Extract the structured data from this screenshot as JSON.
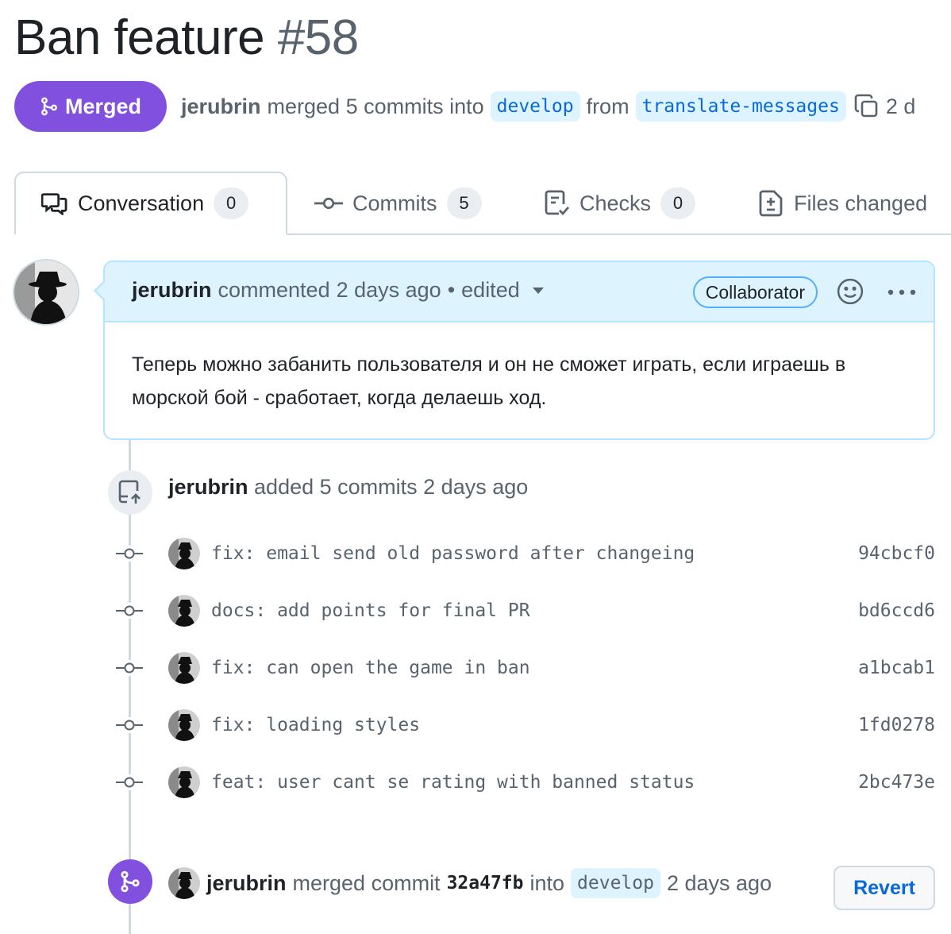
{
  "pr": {
    "title": "Ban feature",
    "number": "#58",
    "state": "Merged",
    "author": "jerubrin",
    "merged_text": "merged 5 commits into",
    "base_branch": "develop",
    "from_text": "from",
    "head_branch": "translate-messages",
    "time_truncated": "2 d"
  },
  "tabs": [
    {
      "label": "Conversation",
      "count": "0",
      "icon": "comment-discussion-icon"
    },
    {
      "label": "Commits",
      "count": "5",
      "icon": "git-commit-icon"
    },
    {
      "label": "Checks",
      "count": "0",
      "icon": "checklist-icon"
    },
    {
      "label": "Files changed",
      "icon": "file-diff-icon"
    }
  ],
  "comment": {
    "author": "jerubrin",
    "action": "commented",
    "time": "2 days ago",
    "separator": "•",
    "edited": "edited",
    "role": "Collaborator",
    "body": "Теперь можно забанить пользователя и он не сможет играть, если играешь в морской бой - сработает, когда делаешь ход."
  },
  "commits_event": {
    "author": "jerubrin",
    "text": "added 5 commits",
    "time": "2 days ago",
    "icon": "repo-push-icon"
  },
  "commits": [
    {
      "message": "fix: email send old password after changeing",
      "sha": "94cbcf0"
    },
    {
      "message": "docs: add points for final PR",
      "sha": "bd6ccd6"
    },
    {
      "message": "fix: can open the game in ban",
      "sha": "a1bcab1"
    },
    {
      "message": "fix: loading styles",
      "sha": "1fd0278"
    },
    {
      "message": "feat: user cant se rating with banned status",
      "sha": "2bc473e"
    }
  ],
  "merge_event": {
    "author": "jerubrin",
    "text": "merged commit",
    "sha": "32a47fb",
    "into": "into",
    "branch": "develop",
    "time": "2 days ago",
    "revert_label": "Revert",
    "icon": "git-merge-icon"
  },
  "colors": {
    "merged": "#8250df",
    "link": "#0969da",
    "branch_bg": "#ddf4ff",
    "comment_header": "#ddf4ff"
  }
}
